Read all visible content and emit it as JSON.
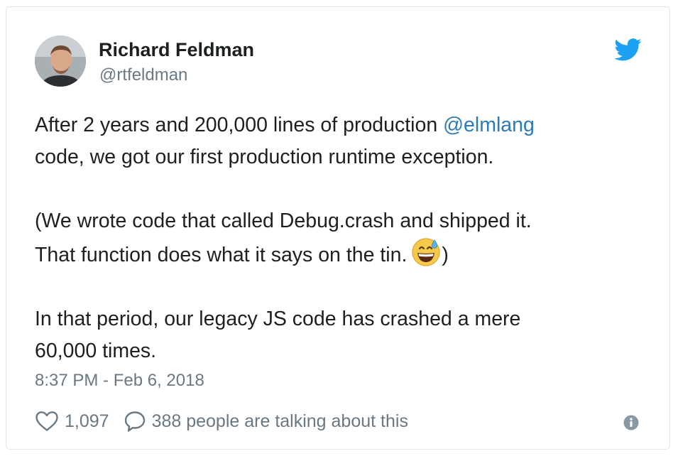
{
  "tweet": {
    "author": {
      "display_name": "Richard Feldman",
      "handle": "@rtfeldman",
      "avatar_icon": "user-avatar"
    },
    "brand_icon": "twitter-bird-icon",
    "colors": {
      "brand": "#1da1f2",
      "link": "#2b7bb9",
      "text": "#1c2022",
      "muted": "#697882"
    },
    "body": {
      "p1_line1": "After 2 years and 200,000 lines of production ",
      "mention": "@elmlang",
      "p1_line2": "code, we got our first production runtime exception.",
      "p2_line1": "(We wrote code that called Debug.crash and shipped it.",
      "p2_line2_before_emoji": "That function does what it says on the tin.",
      "emoji": "grinning-face-with-sweat",
      "p2_line2_after_emoji": ")",
      "p3_line1": "In that period, our legacy JS code has crashed a mere",
      "p3_line2": "60,000 times."
    },
    "timestamp": "8:37 PM - Feb 6, 2018",
    "actions": {
      "like_icon": "heart-icon",
      "like_count": "1,097",
      "reply_icon": "speech-bubble-icon",
      "reply_label": "388 people are talking about this",
      "info_icon": "info-icon"
    }
  }
}
